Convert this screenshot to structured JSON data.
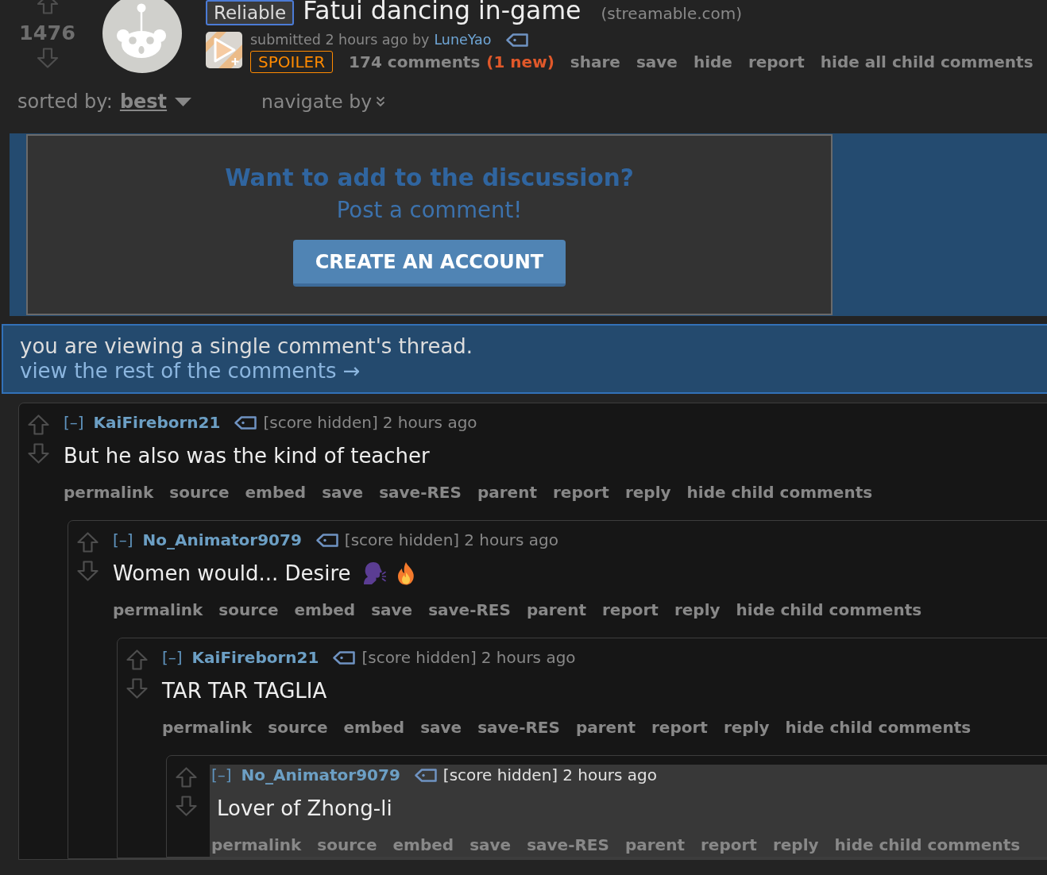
{
  "post": {
    "score": "1476",
    "flair": "Reliable",
    "title": "Fatui dancing in-game",
    "domain": "(streamable.com)",
    "submitted": "submitted 2 hours ago by",
    "author": "LuneYao",
    "spoiler": "SPOILER",
    "comments": "174 comments",
    "new_comments": "(1 new)",
    "actions": [
      "share",
      "save",
      "hide",
      "report",
      "hide all child comments"
    ]
  },
  "sort": {
    "label": "sorted by:",
    "value": "best",
    "navigate": "navigate by"
  },
  "login_prompt": {
    "heading": "Want to add to the discussion?",
    "subheading": "Post a comment!",
    "button": "CREATE AN ACCOUNT"
  },
  "thread_notice": {
    "message": "you are viewing a single comment's thread.",
    "link": "view the rest of the comments →"
  },
  "comments": [
    {
      "collapse": "[–]",
      "author": "KaiFireborn21",
      "score": "[score hidden]",
      "time": "2 hours ago",
      "body": "But he also was the kind of teacher",
      "highlighted": false,
      "actions": [
        "permalink",
        "source",
        "embed",
        "save",
        "save-RES",
        "parent",
        "report",
        "reply",
        "hide child comments"
      ],
      "children": [
        {
          "collapse": "[–]",
          "author": "No_Animator9079",
          "score": "[score hidden]",
          "time": "2 hours ago",
          "body": "Women would... Desire",
          "emoji": [
            {
              "kind": "speaking_head"
            },
            {
              "kind": "fire"
            }
          ],
          "highlighted": false,
          "actions": [
            "permalink",
            "source",
            "embed",
            "save",
            "save-RES",
            "parent",
            "report",
            "reply",
            "hide child comments"
          ],
          "children": [
            {
              "collapse": "[–]",
              "author": "KaiFireborn21",
              "score": "[score hidden]",
              "time": "2 hours ago",
              "body": "TAR TAR TAGLIA",
              "highlighted": false,
              "actions": [
                "permalink",
                "source",
                "embed",
                "save",
                "save-RES",
                "parent",
                "report",
                "reply",
                "hide child comments"
              ],
              "children": [
                {
                  "collapse": "[–]",
                  "author": "No_Animator9079",
                  "score": "[score hidden]",
                  "time": "2 hours ago",
                  "body": "Lover of Zhong-li",
                  "highlighted": true,
                  "actions": [
                    "permalink",
                    "source",
                    "embed",
                    "save",
                    "save-RES",
                    "parent",
                    "report",
                    "reply",
                    "hide child comments"
                  ]
                }
              ]
            }
          ]
        }
      ]
    }
  ]
}
